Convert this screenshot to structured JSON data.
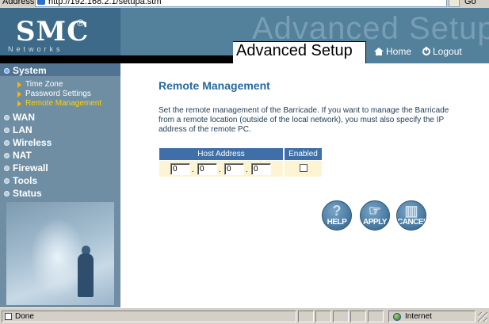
{
  "browser": {
    "address_label": "Address",
    "url": "http://192.168.2.1/setupa.stm",
    "go_label": "Go"
  },
  "header": {
    "logo": "SMC",
    "logo_reg": "®",
    "logo_sub": "Networks",
    "ghost_title": "Advanced Setup",
    "title": "Advanced Setup",
    "home_label": "Home",
    "logout_label": "Logout"
  },
  "sidebar": {
    "items": [
      {
        "label": "System",
        "active": true
      },
      {
        "label": "WAN"
      },
      {
        "label": "LAN"
      },
      {
        "label": "Wireless"
      },
      {
        "label": "NAT"
      },
      {
        "label": "Firewall"
      },
      {
        "label": "Tools"
      },
      {
        "label": "Status"
      }
    ],
    "system_sub": [
      {
        "label": "Time Zone"
      },
      {
        "label": "Password Settings"
      },
      {
        "label": "Remote Management",
        "active": true
      }
    ]
  },
  "main": {
    "title": "Remote Management",
    "description": "Set the remote management of the Barricade. If you want to manage the Barricade from a remote location (outside of the local network), you must also specify the IP address of the remote PC.",
    "table": {
      "col_host": "Host Address",
      "col_enabled": "Enabled",
      "ip": [
        "0",
        "0",
        "0",
        "0"
      ],
      "ip_separator": ".",
      "enabled": false
    },
    "buttons": {
      "help": "HELP",
      "apply": "APPLY",
      "cancel": "CANCEL"
    }
  },
  "statusbar": {
    "done": "Done",
    "zone": "Internet"
  },
  "colors": {
    "header_bg": "#53809a",
    "sidebar_bg": "#6f8ea4",
    "title_blue": "#27699c",
    "table_header": "#3f6fa6",
    "table_cell": "#fdf4d4",
    "active_sub": "#ffd200"
  }
}
